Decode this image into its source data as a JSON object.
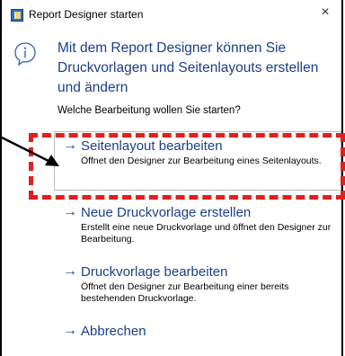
{
  "window": {
    "title": "Report Designer starten",
    "close_symbol": "×",
    "icon": "report-designer-app-icon"
  },
  "content": {
    "heading": "Mit dem Report Designer können Sie Druckvorlagen und Seitenlayouts erstellen und ändern",
    "question": "Welche Bearbeitung wollen Sie starten?",
    "arrow_symbol": "→",
    "options": [
      {
        "label": "Seitenlayout bearbeiten",
        "description": "Öffnet den Designer zur Bearbeitung eines Seitenlayouts."
      },
      {
        "label": "Neue Druckvorlage erstellen",
        "description": "Erstellt eine neue Druckvorlage und öffnet den Designer zur Bearbeitung."
      },
      {
        "label": "Druckvorlage bearbeiten",
        "description": "Öffnet den Designer zur Bearbeitung einer bereits bestehenden Druckvorlage."
      },
      {
        "label": "Abbrechen",
        "description": ""
      }
    ]
  },
  "annotations": {
    "highlight_color": "#e02020",
    "arrow_color": "#000000"
  },
  "colors": {
    "accent": "#1b3f8a"
  }
}
